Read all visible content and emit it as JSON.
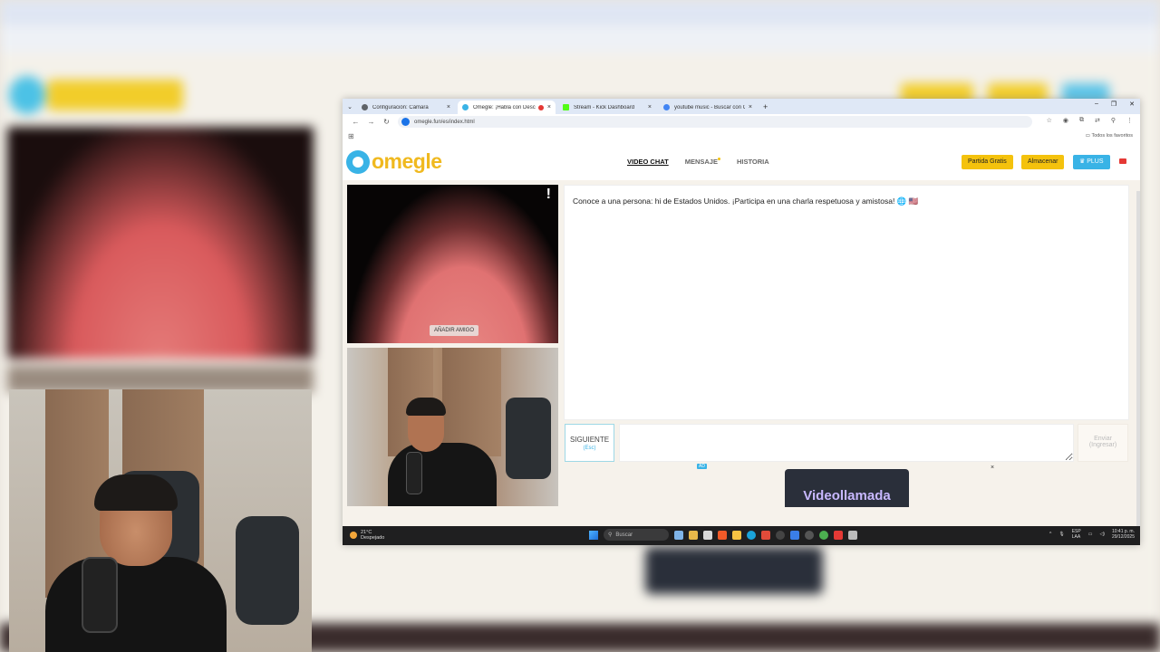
{
  "browser": {
    "tabs": [
      {
        "label": "Configuración: Cámara",
        "active": false,
        "color": "#5f6368"
      },
      {
        "label": "Omegle: ¡Habla con Desco",
        "active": true,
        "color": "#3ab3e6"
      },
      {
        "label": "Stream - Kick Dashboard",
        "active": false,
        "color": "#53fc18"
      },
      {
        "label": "youtube music - Buscar con Go",
        "active": false,
        "color": "#4285f4"
      }
    ],
    "url": "omegle.fun/es/index.html",
    "bookmarks_label": "Todos los favoritos"
  },
  "site": {
    "logo_text": "omegle",
    "nav": {
      "video_chat": "VIDEO CHAT",
      "mensaje": "MENSAJE",
      "historia": "HISTORIA"
    },
    "buttons": {
      "partida": "Partida Gratis",
      "almacenar": "Almacenar",
      "plus": "PLUS"
    },
    "colors": {
      "accent_yellow": "#f4c20d",
      "accent_blue": "#39b3e6"
    }
  },
  "video": {
    "report_label": "!",
    "add_friend_label": "AÑADIR AMIGO"
  },
  "chat": {
    "message": "Conoce a una persona: hi de Estados Unidos. ¡Participa en una charla respetuosa y amistosa! 🌐 🇺🇸",
    "next_label": "SIGUIENTE",
    "next_key": "(Esc)",
    "input_placeholder": "",
    "send_label_line1": "Enviar",
    "send_label_line2": "(Ingresar)"
  },
  "ad": {
    "tag": "AD",
    "close": "×",
    "text": "Videollamada"
  },
  "taskbar": {
    "weather_temp": "21°C",
    "weather_desc": "Despejado",
    "search_label": "Buscar",
    "lang_line1": "ESP",
    "lang_line2": "LAA",
    "time": "10:41 p. m.",
    "date": "29/12/2025"
  }
}
